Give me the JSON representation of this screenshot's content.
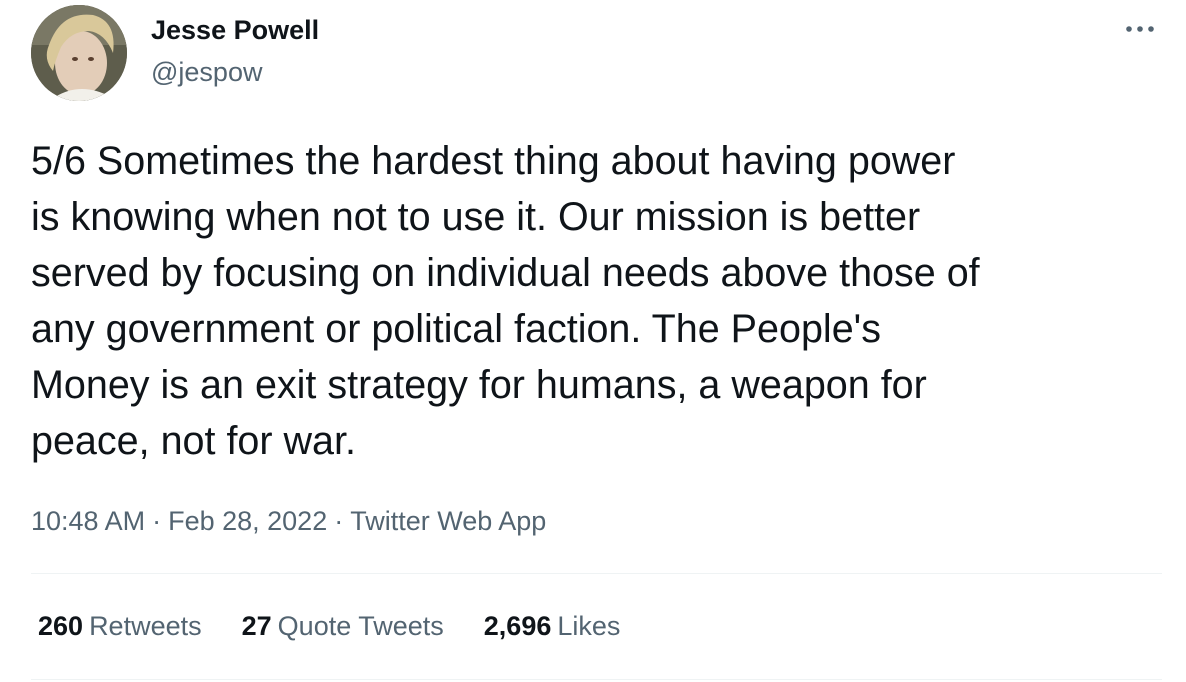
{
  "author": {
    "name": "Jesse Powell",
    "handle": "@jespow"
  },
  "tweet": {
    "text": "5/6 Sometimes the hardest thing about having power\nis knowing when not to use it. Our mission is better\nserved by focusing on individual needs above those of\nany government or political faction. The People's\nMoney is an exit strategy for humans, a weapon for\npeace, not for war."
  },
  "meta": {
    "time": "10:48 AM",
    "separator": "·",
    "date": "Feb 28, 2022",
    "source": "Twitter Web App"
  },
  "stats": {
    "retweets": {
      "count": "260",
      "label": "Retweets"
    },
    "quote_tweets": {
      "count": "27",
      "label": "Quote Tweets"
    },
    "likes": {
      "count": "2,696",
      "label": "Likes"
    }
  },
  "icons": {
    "more": "more-horizontal-icon"
  },
  "colors": {
    "text": "#0f1419",
    "secondary": "#536471",
    "divider": "#eff3f4"
  }
}
